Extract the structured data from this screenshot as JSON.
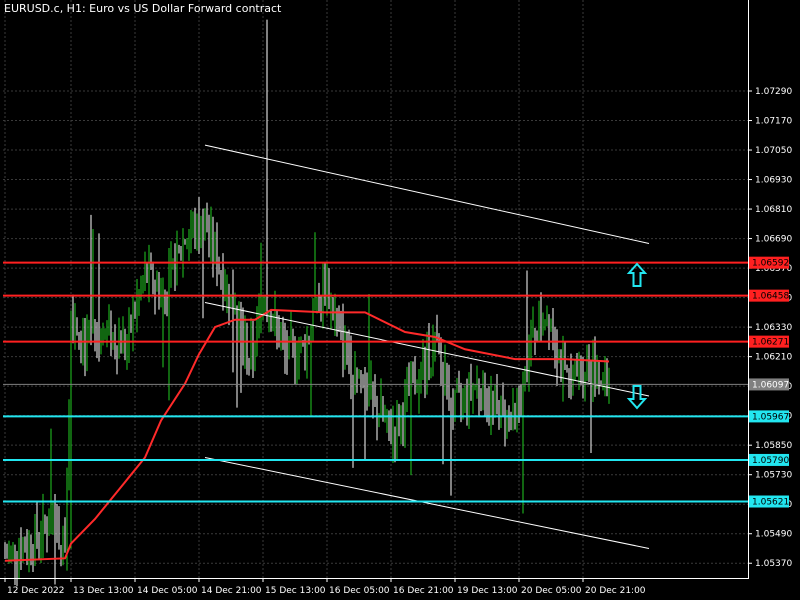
{
  "window": {
    "title": "EURUSD.c, H1:  Euro vs US Dollar Forward contract"
  },
  "colors": {
    "background": "#000000",
    "grid": "#3a3a3a",
    "bull_candle": "#22cc22",
    "bear_candle": "#ffffff",
    "moving_average": "#ff2a2a",
    "resistance": "#ff2020",
    "support": "#22e6f0",
    "channel": "#ffffff",
    "current_price_tag": "#808080"
  },
  "icons": {
    "buy_signal": "arrow-up-icon",
    "sell_signal": "arrow-down-icon"
  },
  "chart_data": {
    "type": "candlestick",
    "symbol": "EURUSD.c",
    "timeframe": "H1",
    "ylim": [
      1.0531,
      1.0766
    ],
    "y_ticks": [
      "1.07290",
      "1.07170",
      "1.07050",
      "1.06930",
      "1.06810",
      "1.06690",
      "1.06570",
      "1.06450",
      "1.06330",
      "1.06210",
      "1.06090",
      "1.05970",
      "1.05850",
      "1.05730",
      "1.05610",
      "1.05490",
      "1.05370"
    ],
    "x_ticks": [
      {
        "label": "12 Dec 2022",
        "bar": 0
      },
      {
        "label": "13 Dec 13:00",
        "bar": 33
      },
      {
        "label": "14 Dec 05:00",
        "bar": 65
      },
      {
        "label": "14 Dec 21:00",
        "bar": 97
      },
      {
        "label": "15 Dec 13:00",
        "bar": 129
      },
      {
        "label": "16 Dec 05:00",
        "bar": 161
      },
      {
        "label": "16 Dec 21:00",
        "bar": 193
      },
      {
        "label": "19 Dec 13:00",
        "bar": 225
      },
      {
        "label": "20 Dec 05:00",
        "bar": 257
      },
      {
        "label": "20 Dec 21:00",
        "bar": 289
      }
    ],
    "bars_count": 303,
    "current_price": "1.06097",
    "resistance_levels": [
      "1.06592",
      "1.06458",
      "1.06271"
    ],
    "support_levels": [
      "1.05967",
      "1.05790",
      "1.05621"
    ],
    "channel": {
      "upper": {
        "from": {
          "bar": 100,
          "price": 1.0707
        },
        "to": {
          "bar": 322,
          "price": 1.0667
        }
      },
      "middle": {
        "from": {
          "bar": 100,
          "price": 1.0643
        },
        "to": {
          "bar": 322,
          "price": 1.0605
        }
      },
      "lower": {
        "from": {
          "bar": 100,
          "price": 1.058
        },
        "to": {
          "bar": 322,
          "price": 1.0543
        }
      }
    },
    "ma_points": [
      {
        "bar": 0,
        "price": 1.0538
      },
      {
        "bar": 30,
        "price": 1.0539
      },
      {
        "bar": 33,
        "price": 1.0545
      },
      {
        "bar": 45,
        "price": 1.0555
      },
      {
        "bar": 60,
        "price": 1.057
      },
      {
        "bar": 70,
        "price": 1.058
      },
      {
        "bar": 78,
        "price": 1.0595
      },
      {
        "bar": 90,
        "price": 1.061
      },
      {
        "bar": 97,
        "price": 1.0622
      },
      {
        "bar": 105,
        "price": 1.0633
      },
      {
        "bar": 115,
        "price": 1.0636
      },
      {
        "bar": 125,
        "price": 1.0636
      },
      {
        "bar": 133,
        "price": 1.064
      },
      {
        "bar": 160,
        "price": 1.0639
      },
      {
        "bar": 180,
        "price": 1.0639
      },
      {
        "bar": 200,
        "price": 1.0631
      },
      {
        "bar": 215,
        "price": 1.0629
      },
      {
        "bar": 230,
        "price": 1.0624
      },
      {
        "bar": 255,
        "price": 1.062
      },
      {
        "bar": 280,
        "price": 1.062
      },
      {
        "bar": 302,
        "price": 1.0619
      }
    ],
    "price_path": [
      {
        "bar": 0,
        "price": 1.054
      },
      {
        "bar": 12,
        "price": 1.0545
      },
      {
        "bar": 22,
        "price": 1.0553
      },
      {
        "bar": 30,
        "price": 1.0545
      },
      {
        "bar": 33,
        "price": 1.064
      },
      {
        "bar": 40,
        "price": 1.0625
      },
      {
        "bar": 50,
        "price": 1.0632
      },
      {
        "bar": 60,
        "price": 1.0625
      },
      {
        "bar": 70,
        "price": 1.0655
      },
      {
        "bar": 80,
        "price": 1.0645
      },
      {
        "bar": 90,
        "price": 1.067
      },
      {
        "bar": 100,
        "price": 1.0675
      },
      {
        "bar": 108,
        "price": 1.0655
      },
      {
        "bar": 115,
        "price": 1.064
      },
      {
        "bar": 122,
        "price": 1.0618
      },
      {
        "bar": 130,
        "price": 1.0645
      },
      {
        "bar": 140,
        "price": 1.0622
      },
      {
        "bar": 150,
        "price": 1.0625
      },
      {
        "bar": 160,
        "price": 1.065
      },
      {
        "bar": 170,
        "price": 1.0625
      },
      {
        "bar": 182,
        "price": 1.0605
      },
      {
        "bar": 193,
        "price": 1.059
      },
      {
        "bar": 205,
        "price": 1.061
      },
      {
        "bar": 215,
        "price": 1.0625
      },
      {
        "bar": 225,
        "price": 1.06
      },
      {
        "bar": 235,
        "price": 1.061
      },
      {
        "bar": 245,
        "price": 1.06
      },
      {
        "bar": 255,
        "price": 1.0595
      },
      {
        "bar": 265,
        "price": 1.0632
      },
      {
        "bar": 272,
        "price": 1.064
      },
      {
        "bar": 280,
        "price": 1.061
      },
      {
        "bar": 290,
        "price": 1.0618
      },
      {
        "bar": 302,
        "price": 1.061
      }
    ]
  }
}
